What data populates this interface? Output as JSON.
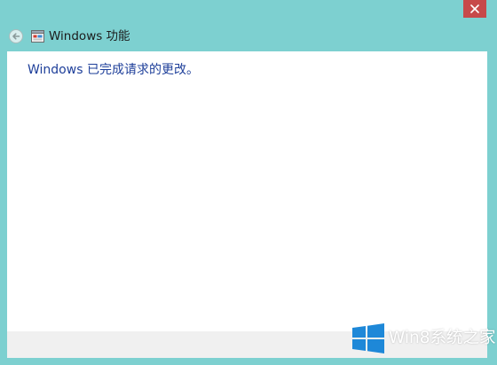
{
  "window": {
    "title": "Windows 功能",
    "close_label": "关闭"
  },
  "nav": {
    "back_label": "后退"
  },
  "content": {
    "message": "Windows 已完成请求的更改。"
  },
  "watermark": {
    "text": "Win8系统之家"
  },
  "colors": {
    "frame": "#7dd0d0",
    "close_button": "#c7494a",
    "message_text": "#1e3f9a",
    "footer": "#f0f0f0",
    "logo_blue": "#1e88d8"
  },
  "icons": [
    "close-icon",
    "back-arrow-icon",
    "windows-features-icon",
    "windows-logo-icon"
  ]
}
